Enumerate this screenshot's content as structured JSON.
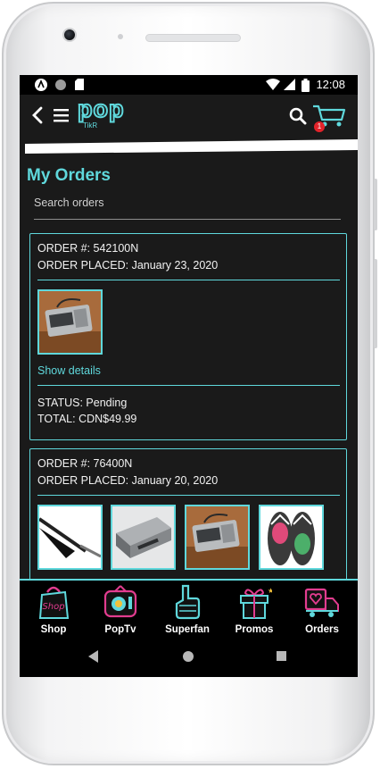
{
  "status_bar": {
    "time": "12:08"
  },
  "app_bar": {
    "logo_main": "pop",
    "logo_sub": "TikR",
    "cart_badge": "1"
  },
  "page": {
    "title": "My Orders",
    "search_placeholder": "Search orders"
  },
  "orders": [
    {
      "order_number": "ORDER #: 542100N",
      "placed": "ORDER PLACED: January 23, 2020",
      "show_details": "Show details",
      "status": "STATUS: Pending",
      "total": "TOTAL: CDN$49.99",
      "items": [
        "radio"
      ]
    },
    {
      "order_number": "ORDER #: 76400N",
      "placed": "ORDER PLACED: January 20, 2020",
      "items": [
        "guitar",
        "vcr",
        "radio",
        "flip-flops"
      ]
    }
  ],
  "bottom_nav": [
    {
      "label": "Shop",
      "icon": "shop-bag-icon"
    },
    {
      "label": "PopTv",
      "icon": "tv-icon"
    },
    {
      "label": "Superfan",
      "icon": "foam-finger-icon"
    },
    {
      "label": "Promos",
      "icon": "gift-icon"
    },
    {
      "label": "Orders",
      "icon": "orders-truck-icon"
    }
  ],
  "colors": {
    "accent": "#5fd8dc",
    "background": "#1a1a1a",
    "badge": "#e2232a"
  }
}
